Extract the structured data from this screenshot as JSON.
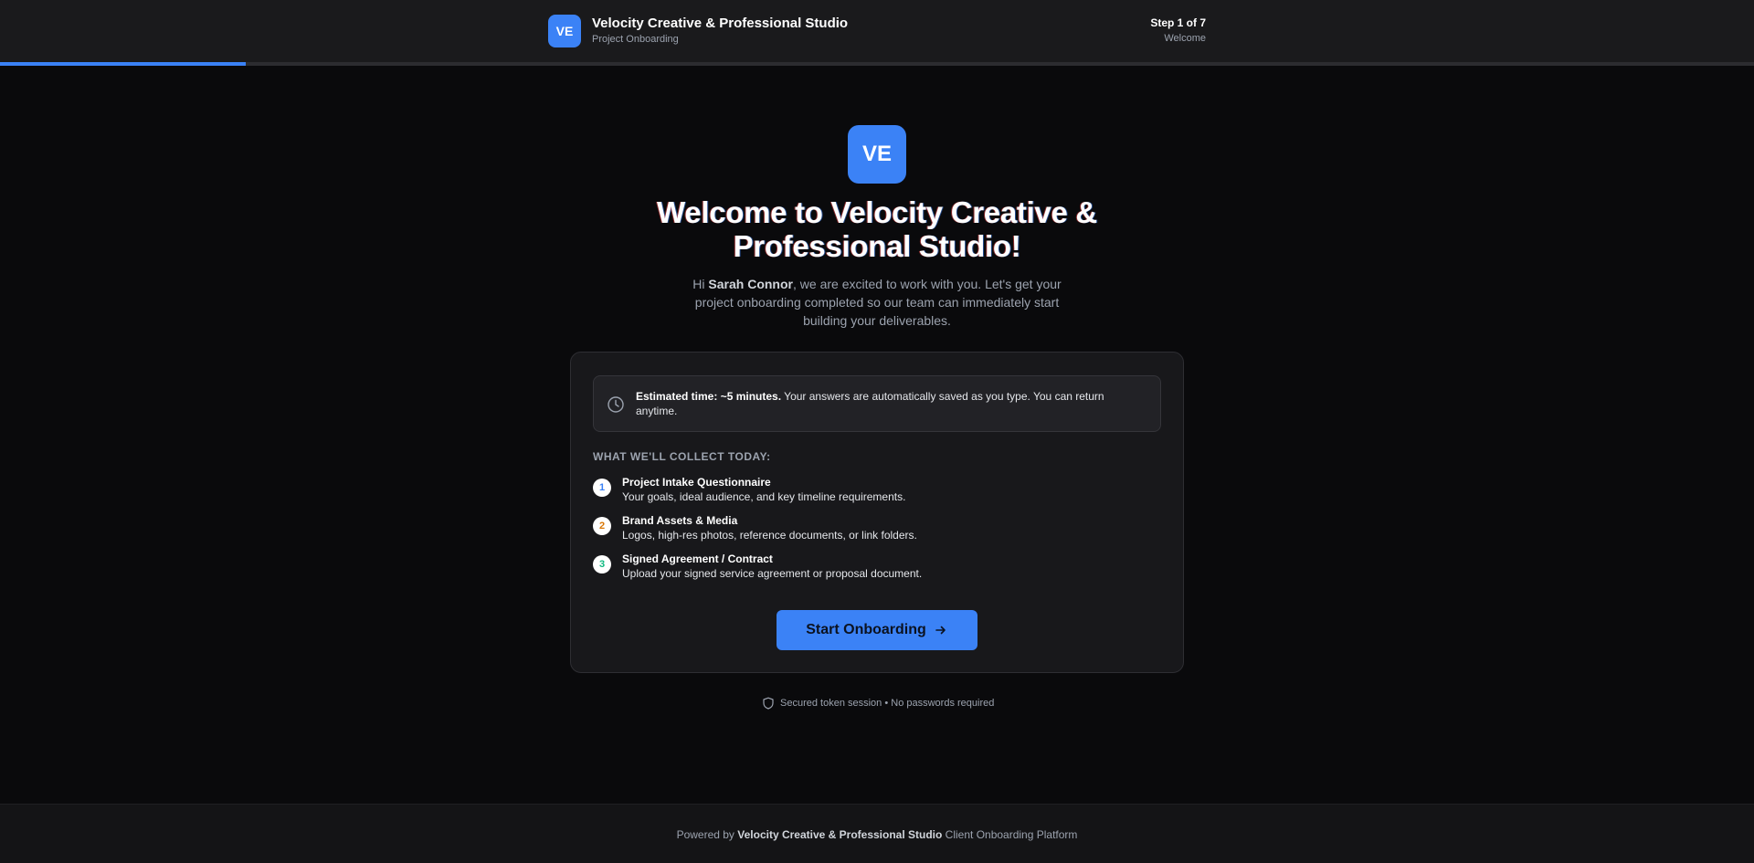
{
  "header": {
    "badge": "VE",
    "company_name": "Velocity Creative & Professional Studio",
    "subtitle": "Project Onboarding",
    "step_label": "Step 1 of 7",
    "step_name": "Welcome",
    "progress_fraction": 0.14
  },
  "hero": {
    "badge": "VE",
    "title": "Welcome to Velocity Creative & Professional Studio!",
    "greeting_prefix": "Hi ",
    "client_name": "Sarah Connor",
    "greeting_rest": ", we are excited to work with you. Let's get your project onboarding completed so our team can immediately start building your deliverables."
  },
  "card": {
    "info_bold": "Estimated time: ~5 minutes.",
    "info_rest": " Your answers are automatically saved as you type. You can return anytime.",
    "section_label": "WHAT WE'LL COLLECT TODAY:",
    "items": [
      {
        "number": "1",
        "title": "Project Intake Questionnaire",
        "description": "Your goals, ideal audience, and key timeline requirements.",
        "color": "#3b82f6"
      },
      {
        "number": "2",
        "title": "Brand Assets & Media",
        "description": "Logos, high-res photos, reference documents, or link folders.",
        "color": "#d97706"
      },
      {
        "number": "3",
        "title": "Signed Agreement / Contract",
        "description": "Upload your signed service agreement or proposal document.",
        "color": "#10b981"
      }
    ],
    "start_button": "Start Onboarding"
  },
  "security_note": "Secured token session • No passwords required",
  "footer": {
    "prefix": "Powered by ",
    "company": "Velocity Creative & Professional Studio",
    "suffix": " Client Onboarding Platform"
  },
  "colors": {
    "accent": "#3b82f6",
    "background": "#0a0a0c",
    "card": "#18181b"
  }
}
